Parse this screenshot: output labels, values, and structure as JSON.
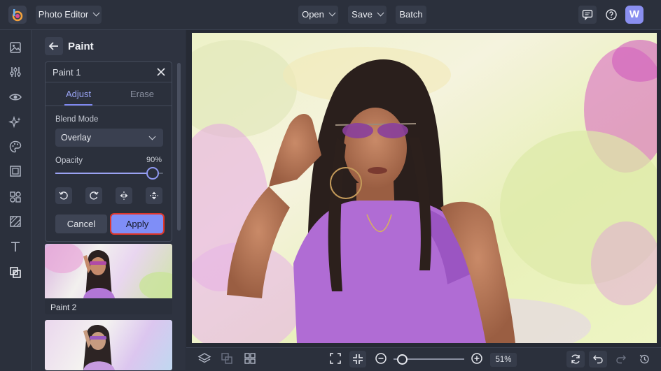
{
  "app": {
    "title": "Photo Editor",
    "user_initial": "W"
  },
  "topbar": {
    "open_label": "Open",
    "save_label": "Save",
    "batch_label": "Batch"
  },
  "left_rail": {
    "icons": [
      "image-icon",
      "sliders-icon",
      "eye-icon",
      "sparkle-icon",
      "palette-icon",
      "frame-icon",
      "shapes-icon",
      "texture-icon",
      "text-icon",
      "overlay-icon"
    ]
  },
  "panel": {
    "title": "Paint",
    "card": {
      "title": "Paint 1",
      "tabs": [
        "Adjust",
        "Erase"
      ],
      "active_tab": "Adjust",
      "blend_mode_label": "Blend Mode",
      "blend_mode_value": "Overlay",
      "opacity_label": "Opacity",
      "opacity_value": "90%",
      "opacity_fraction": 0.9,
      "tools": [
        "rotate-left-icon",
        "rotate-right-icon",
        "flip-horizontal-icon",
        "flip-vertical-icon"
      ],
      "cancel_label": "Cancel",
      "apply_label": "Apply"
    },
    "presets": [
      {
        "label": "Paint 2"
      },
      {
        "label": ""
      }
    ]
  },
  "bottombar": {
    "zoom_value": "51%",
    "zoom_fraction": 0.05
  },
  "colors": {
    "accent": "#7f8ef7",
    "highlight": "#e0362a",
    "background": "#2a2f3b"
  }
}
